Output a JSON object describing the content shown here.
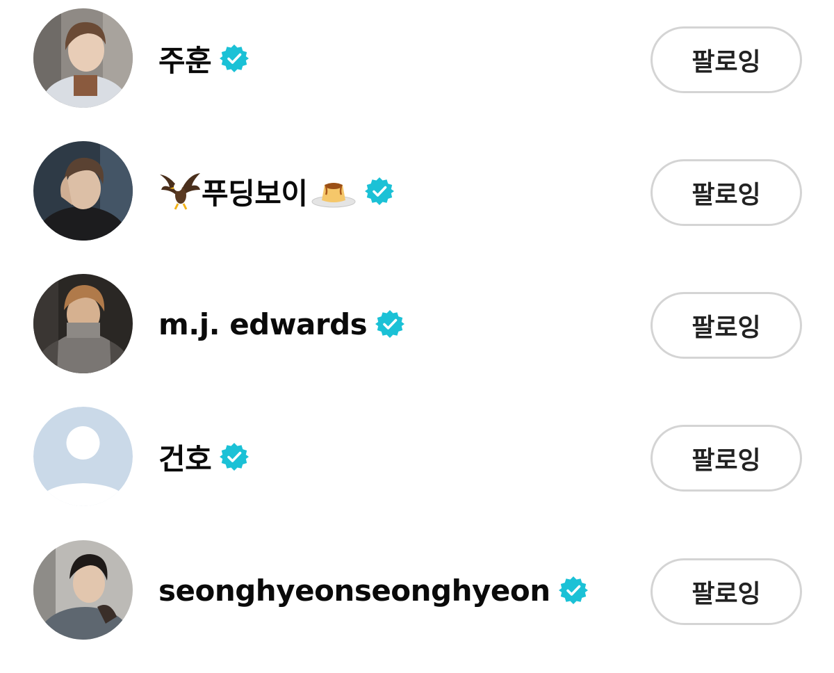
{
  "accent_color": "#1bc1d6",
  "follow_list": [
    {
      "name": "주훈",
      "verified": true,
      "avatar": "photo",
      "button_label": "팔로잉"
    },
    {
      "name": "푸딩보이",
      "leading_emoji": "eagle-icon",
      "trailing_emoji": "pudding-icon",
      "verified": true,
      "avatar": "photo",
      "button_label": "팔로잉"
    },
    {
      "name": "m.j. edwards",
      "verified": true,
      "avatar": "photo",
      "button_label": "팔로잉"
    },
    {
      "name": "건호",
      "verified": true,
      "avatar": "default-avatar-icon",
      "button_label": "팔로잉"
    },
    {
      "name": "seonghyeonseonghyeon",
      "verified": true,
      "avatar": "photo",
      "button_label": "팔로잉"
    }
  ]
}
